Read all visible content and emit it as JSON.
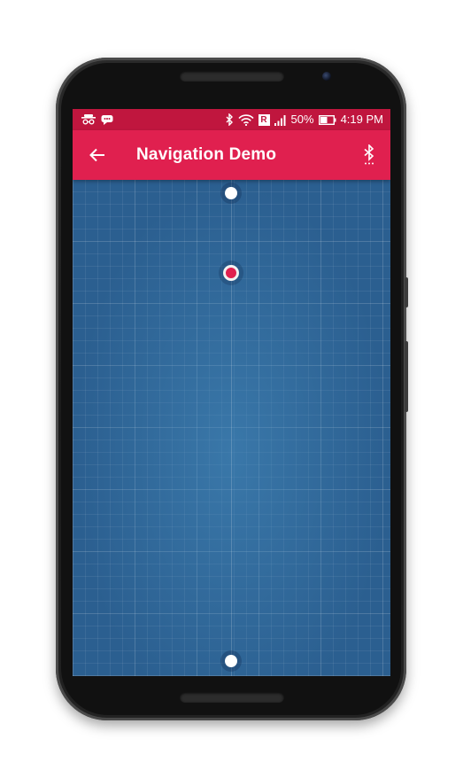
{
  "status_bar": {
    "left_icons": [
      "incognito-icon",
      "chat-bubble-icon"
    ],
    "right_icons": [
      "bluetooth-icon",
      "wifi-icon",
      "roaming-icon",
      "cell-signal-icon",
      "battery-icon"
    ],
    "battery_percent": "50%",
    "time": "4:19 PM",
    "roaming_glyph": "R"
  },
  "app_bar": {
    "title": "Navigation Demo",
    "back_icon": "arrow-back-icon",
    "action_icon": "bluetooth-searching-icon"
  },
  "map": {
    "background_color": "#2b5f90",
    "waypoints": [
      "start-waypoint",
      "end-waypoint"
    ],
    "robot_marker_color": "#e0204f"
  },
  "fab": {
    "icon": "stop-icon",
    "color": "#e91e63"
  },
  "colors": {
    "status_bar": "#c0163e",
    "app_bar": "#e0204f",
    "accent": "#e91e63"
  }
}
